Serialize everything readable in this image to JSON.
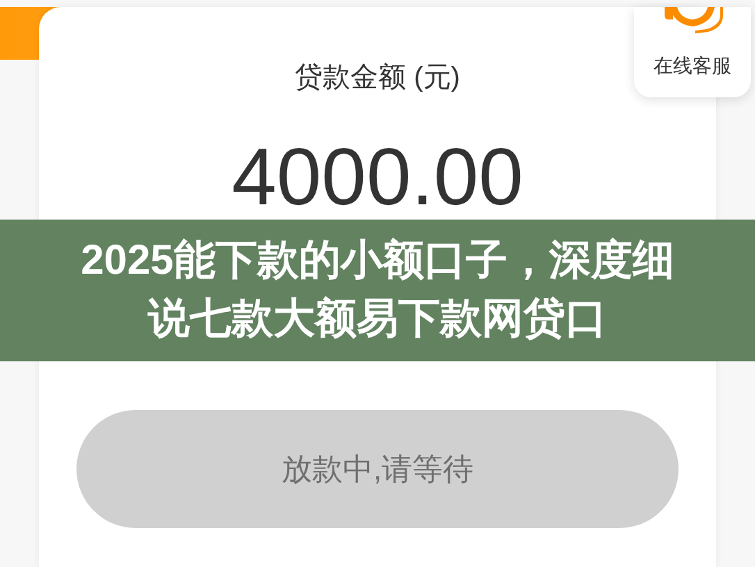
{
  "loan_card": {
    "label": "贷款金额 (元)",
    "amount": "4000.00",
    "button": {
      "label": "放款中,请等待",
      "disabled": true
    }
  },
  "customer_service": {
    "label": "在线客服"
  },
  "banner": {
    "title": "2025能下款的小额口子，深度细说七款大额易下款网贷口"
  }
}
